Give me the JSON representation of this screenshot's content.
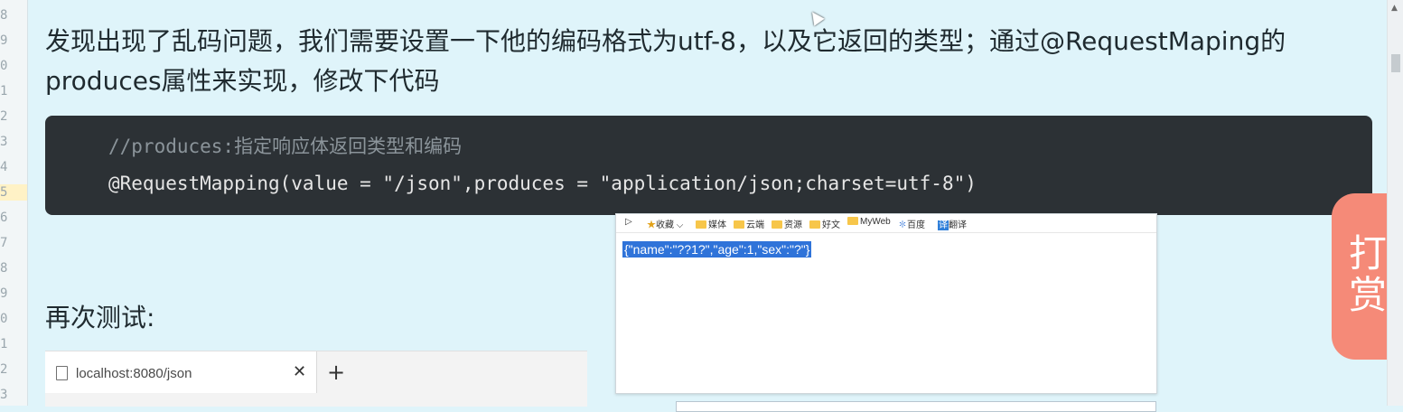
{
  "gutter": {
    "line_numbers": [
      "8",
      "9",
      "0",
      "1",
      "2",
      "3",
      "4",
      "5",
      "6",
      "7",
      "8",
      "9",
      "0",
      "1",
      "2",
      "3"
    ],
    "active_index": 7
  },
  "article": {
    "paragraph": "发现出现了乱码问题，我们需要设置一下他的编码格式为utf-8，以及它返回的类型；通过@RequestMaping的produces属性来实现，修改下代码",
    "code_comment": "//produces:指定响应体返回类型和编码",
    "code_line": "@RequestMapping(value = \"/json\",produces = \"application/json;charset=utf-8\")",
    "retest_label": "再次测试:"
  },
  "browser": {
    "tab_url": "localhost:8080/json",
    "close_symbol": "✕",
    "new_tab_symbol": "+"
  },
  "popup": {
    "bookmarks": [
      {
        "label": "收藏 ⌵",
        "icon": "star-icon"
      },
      {
        "label": "媒体",
        "icon": "folder-icon"
      },
      {
        "label": "云端",
        "icon": "folder-icon"
      },
      {
        "label": "资源",
        "icon": "folder-icon"
      },
      {
        "label": "好文",
        "icon": "folder-icon"
      },
      {
        "label": "MyWeb",
        "icon": "folder-icon"
      },
      {
        "label": "百度",
        "icon": "baidu-icon"
      },
      {
        "label": "翻译",
        "icon": "translate-icon"
      }
    ],
    "json_text": "{\"name\":\"??1?\",\"age\":1,\"sex\":\"?\"}"
  },
  "reward": {
    "char1": "打",
    "char2": "赏"
  },
  "colors": {
    "accent": "#f58a78",
    "selection": "#2f73d9",
    "code_bg": "#2c3135"
  }
}
